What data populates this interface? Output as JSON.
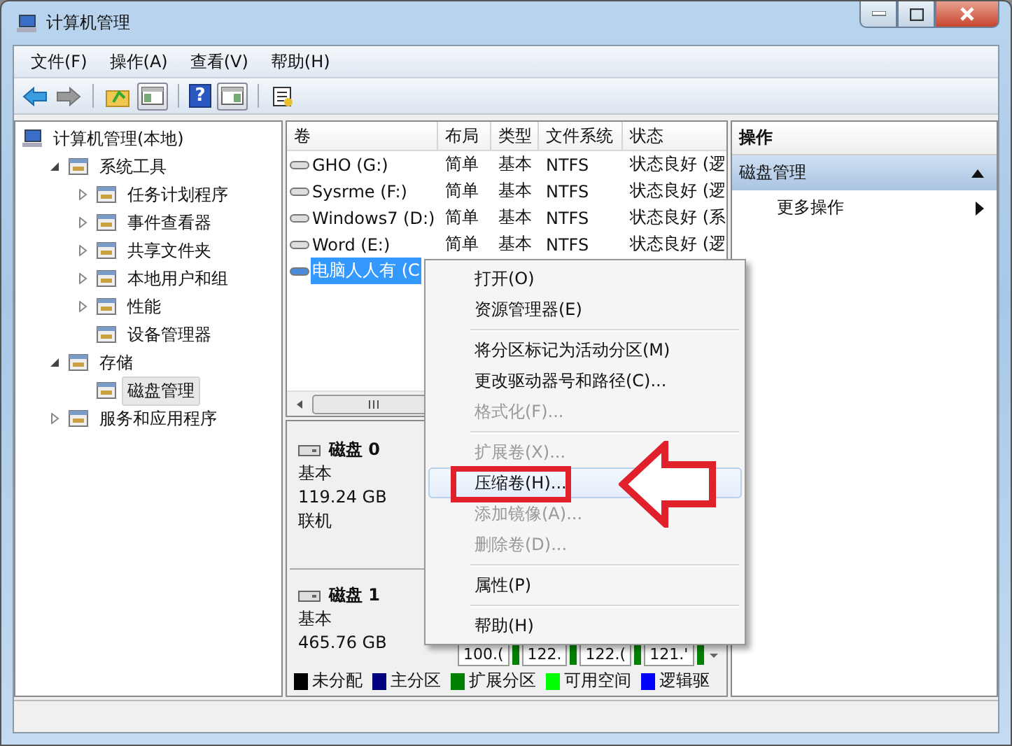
{
  "window": {
    "title": "计算机管理"
  },
  "menu": [
    "文件(F)",
    "操作(A)",
    "查看(V)",
    "帮助(H)"
  ],
  "toolbar": {
    "help_glyph": "?"
  },
  "tree": [
    {
      "label": "计算机管理(本地)",
      "selected": false,
      "children": [
        {
          "label": "系统工具",
          "expanded": true,
          "selected": false,
          "children": [
            {
              "label": "任务计划程序",
              "expanded": false,
              "selected": false
            },
            {
              "label": "事件查看器",
              "expanded": false,
              "selected": false
            },
            {
              "label": "共享文件夹",
              "expanded": false,
              "selected": false
            },
            {
              "label": "本地用户和组",
              "expanded": false,
              "selected": false
            },
            {
              "label": "性能",
              "expanded": false,
              "selected": false
            },
            {
              "label": "设备管理器",
              "selected": false
            }
          ]
        },
        {
          "label": "存储",
          "expanded": true,
          "selected": false,
          "children": [
            {
              "label": "磁盘管理",
              "selected": true
            }
          ]
        },
        {
          "label": "服务和应用程序",
          "expanded": false,
          "selected": false
        }
      ]
    }
  ],
  "volumes": {
    "columns": [
      "卷",
      "布局",
      "类型",
      "文件系统",
      "状态"
    ],
    "rows": [
      {
        "cells": [
          "GHO (G:)",
          "简单",
          "基本",
          "NTFS",
          "状态良好 (逻"
        ],
        "selected": false
      },
      {
        "cells": [
          "Sysrme (F:)",
          "简单",
          "基本",
          "NTFS",
          "状态良好 (逻"
        ],
        "selected": false
      },
      {
        "cells": [
          "Windows7 (D:)",
          "简单",
          "基本",
          "NTFS",
          "状态良好 (系"
        ],
        "selected": false
      },
      {
        "cells": [
          "Word (E:)",
          "简单",
          "基本",
          "NTFS",
          "状态良好 (逻"
        ],
        "selected": false
      },
      {
        "cells": [
          "电脑人人有 (C"
        ],
        "selected": true
      }
    ]
  },
  "disks": [
    {
      "name": "磁盘 0",
      "type": "基本",
      "size": "119.24 GB",
      "status": "联机"
    },
    {
      "name": "磁盘 1",
      "type": "基本",
      "size": "465.76 GB",
      "partitions": [
        "100.(",
        "122.",
        "122.(",
        "121.'"
      ]
    }
  ],
  "legend": [
    {
      "label": "未分配",
      "color": "#000000"
    },
    {
      "label": "主分区",
      "color": "#000080"
    },
    {
      "label": "扩展分区",
      "color": "#008000"
    },
    {
      "label": "可用空间",
      "color": "#00ff00"
    },
    {
      "label": "逻辑驱",
      "color": "#0000ff"
    }
  ],
  "actions": {
    "title": "操作",
    "section": "磁盘管理",
    "items": [
      "更多操作"
    ]
  },
  "context_menu": [
    {
      "kind": "item",
      "label": "打开(O)",
      "disabled": false,
      "highlighted": false
    },
    {
      "kind": "item",
      "label": "资源管理器(E)",
      "disabled": false,
      "highlighted": false
    },
    {
      "kind": "separator"
    },
    {
      "kind": "item",
      "label": "将分区标记为活动分区(M)",
      "disabled": false,
      "highlighted": false
    },
    {
      "kind": "item",
      "label": "更改驱动器号和路径(C)...",
      "disabled": false,
      "highlighted": false
    },
    {
      "kind": "item",
      "label": "格式化(F)...",
      "disabled": true,
      "highlighted": false
    },
    {
      "kind": "separator"
    },
    {
      "kind": "item",
      "label": "扩展卷(X)...",
      "disabled": true,
      "highlighted": false
    },
    {
      "kind": "item",
      "label": "压缩卷(H)...",
      "disabled": false,
      "highlighted": true
    },
    {
      "kind": "item",
      "label": "添加镜像(A)...",
      "disabled": true,
      "highlighted": false
    },
    {
      "kind": "item",
      "label": "删除卷(D)...",
      "disabled": true,
      "highlighted": false
    },
    {
      "kind": "separator"
    },
    {
      "kind": "item",
      "label": "属性(P)",
      "disabled": false,
      "highlighted": false
    },
    {
      "kind": "separator"
    },
    {
      "kind": "item",
      "label": "帮助(H)",
      "disabled": false,
      "highlighted": false
    }
  ]
}
